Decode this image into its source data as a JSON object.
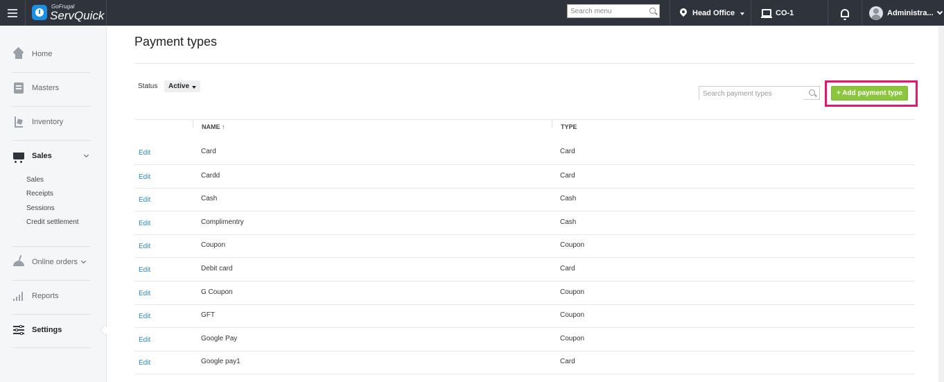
{
  "topbar": {
    "logo_small": "GoFrugal",
    "logo_big": "ServQuick",
    "search_placeholder": "Search menu",
    "location": "Head Office",
    "counter": "CO-1",
    "user": "Administra..."
  },
  "sidebar": {
    "items": [
      {
        "label": "Home",
        "icon": "home-icon"
      },
      {
        "label": "Masters",
        "icon": "masters-icon"
      },
      {
        "label": "Inventory",
        "icon": "inventory-icon"
      },
      {
        "label": "Sales",
        "icon": "cart-icon",
        "expanded": true
      },
      {
        "label": "Online orders",
        "icon": "online-orders-icon"
      },
      {
        "label": "Reports",
        "icon": "reports-icon"
      },
      {
        "label": "Settings",
        "icon": "settings-icon",
        "active": true
      }
    ],
    "sales_sub": [
      "Sales",
      "Receipts",
      "Sessions",
      "Credit settlement"
    ]
  },
  "main": {
    "title": "Payment types",
    "status_label": "Status",
    "status_value": "Active",
    "search_placeholder": "Search payment types",
    "add_button": "+ Add payment type",
    "columns": {
      "name": "NAME ↑",
      "type": "TYPE"
    },
    "edit_label": "Edit",
    "rows": [
      {
        "name": "Card",
        "type": "Card"
      },
      {
        "name": "Cardd",
        "type": "Card"
      },
      {
        "name": "Cash",
        "type": "Cash"
      },
      {
        "name": "Complimentry",
        "type": "Cash"
      },
      {
        "name": "Coupon",
        "type": "Coupon"
      },
      {
        "name": "Debit card",
        "type": "Card"
      },
      {
        "name": "G Coupon",
        "type": "Coupon"
      },
      {
        "name": "GFT",
        "type": "Coupon"
      },
      {
        "name": "Google Pay",
        "type": "Coupon"
      },
      {
        "name": "Google pay1",
        "type": "Card"
      }
    ]
  },
  "colors": {
    "topbar": "#2e333c",
    "accent_green": "#8cc63f",
    "link_blue": "#2a86c8",
    "highlight": "#e6166f"
  }
}
